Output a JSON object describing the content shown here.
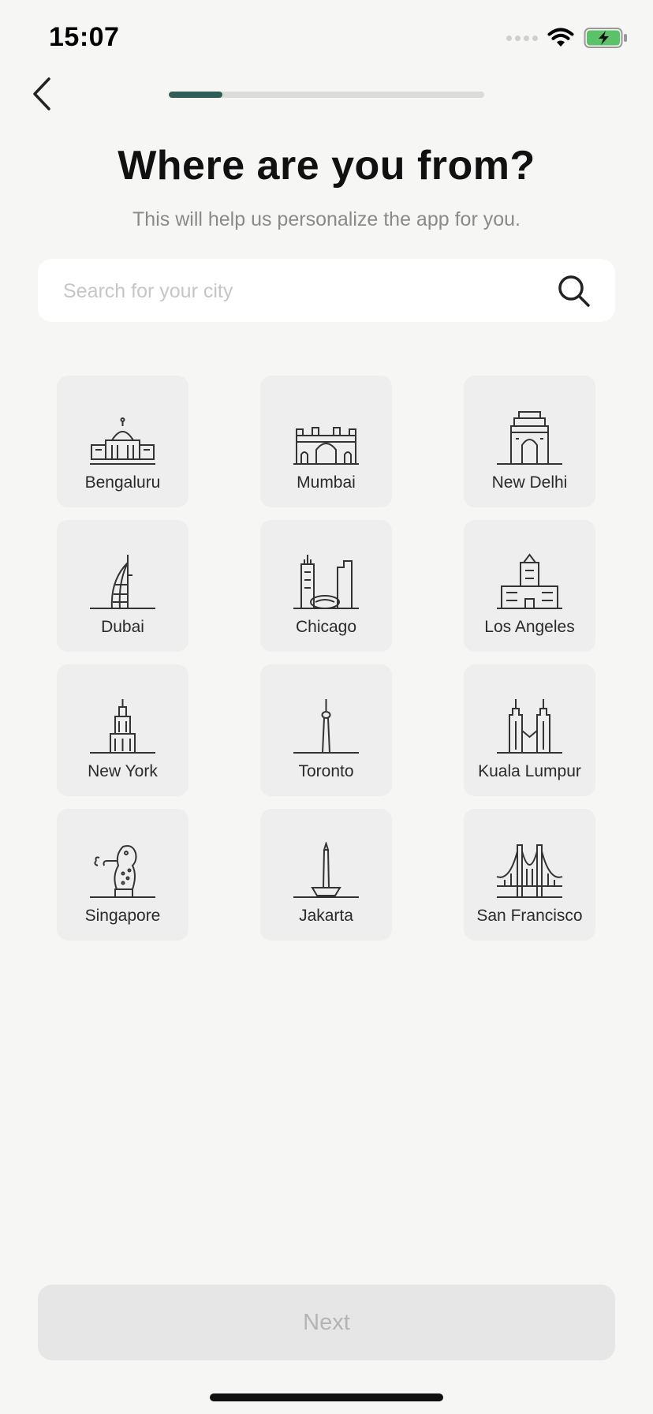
{
  "status": {
    "time": "15:07"
  },
  "progress": {
    "fraction": 0.17,
    "color": "#2f5e56"
  },
  "header": {
    "title": "Where are you from?",
    "subtitle": "This will help us personalize the app for you."
  },
  "search": {
    "placeholder": "Search for your city",
    "value": ""
  },
  "cities": [
    {
      "name": "Bengaluru",
      "icon": "vidhana-soudha-icon"
    },
    {
      "name": "Mumbai",
      "icon": "gateway-of-india-icon"
    },
    {
      "name": "New Delhi",
      "icon": "india-gate-icon"
    },
    {
      "name": "Dubai",
      "icon": "burj-al-arab-icon"
    },
    {
      "name": "Chicago",
      "icon": "cloud-gate-icon"
    },
    {
      "name": "Los Angeles",
      "icon": "city-hall-icon"
    },
    {
      "name": "New York",
      "icon": "empire-state-icon"
    },
    {
      "name": "Toronto",
      "icon": "cn-tower-icon"
    },
    {
      "name": "Kuala Lumpur",
      "icon": "petronas-towers-icon"
    },
    {
      "name": "Singapore",
      "icon": "merlion-icon"
    },
    {
      "name": "Jakarta",
      "icon": "monas-icon"
    },
    {
      "name": "San Francisco",
      "icon": "golden-gate-icon"
    }
  ],
  "footer": {
    "next_label": "Next"
  }
}
